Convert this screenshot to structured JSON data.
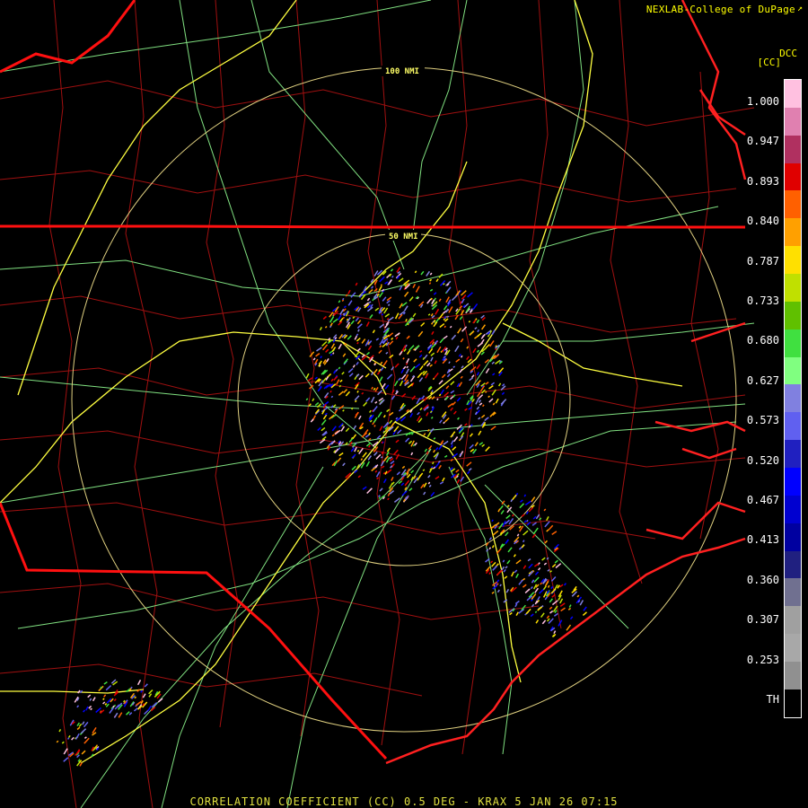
{
  "credit": "NEXLAB-College of DuPage",
  "credit_icon": "external-link-icon",
  "product_code": "DCC",
  "unit": "[CC]",
  "footer": "CORRELATION COEFFICIENT (CC) 0.5 DEG - KRAX 5 JAN 26 07:15",
  "range_rings": [
    "100 NMI",
    "50 NMI"
  ],
  "scale": {
    "ticks": [
      "1.000",
      "0.947",
      "0.893",
      "0.840",
      "0.787",
      "0.733",
      "0.680",
      "0.627",
      "0.573",
      "0.520",
      "0.467",
      "0.413",
      "0.360",
      "0.307",
      "0.253",
      "TH"
    ],
    "colors": [
      "#ffc0e0",
      "#e080b0",
      "#b03060",
      "#e00000",
      "#ff6000",
      "#ffa000",
      "#ffe000",
      "#c0e000",
      "#60c000",
      "#40e040",
      "#80ff80",
      "#8080e0",
      "#6060f0",
      "#2020c0",
      "#0000ff",
      "#0000d0",
      "#0000a0",
      "#202080",
      "#707090",
      "#a0a0a0",
      "#a8a8a8",
      "#909090",
      "#000000"
    ]
  },
  "colors": {
    "state_border": "#ff1010",
    "county_border": "#a01010",
    "interstate": "#ffff40",
    "highway": "#80e080",
    "range_ring": "#e0d080",
    "coast": "#ff2020"
  }
}
